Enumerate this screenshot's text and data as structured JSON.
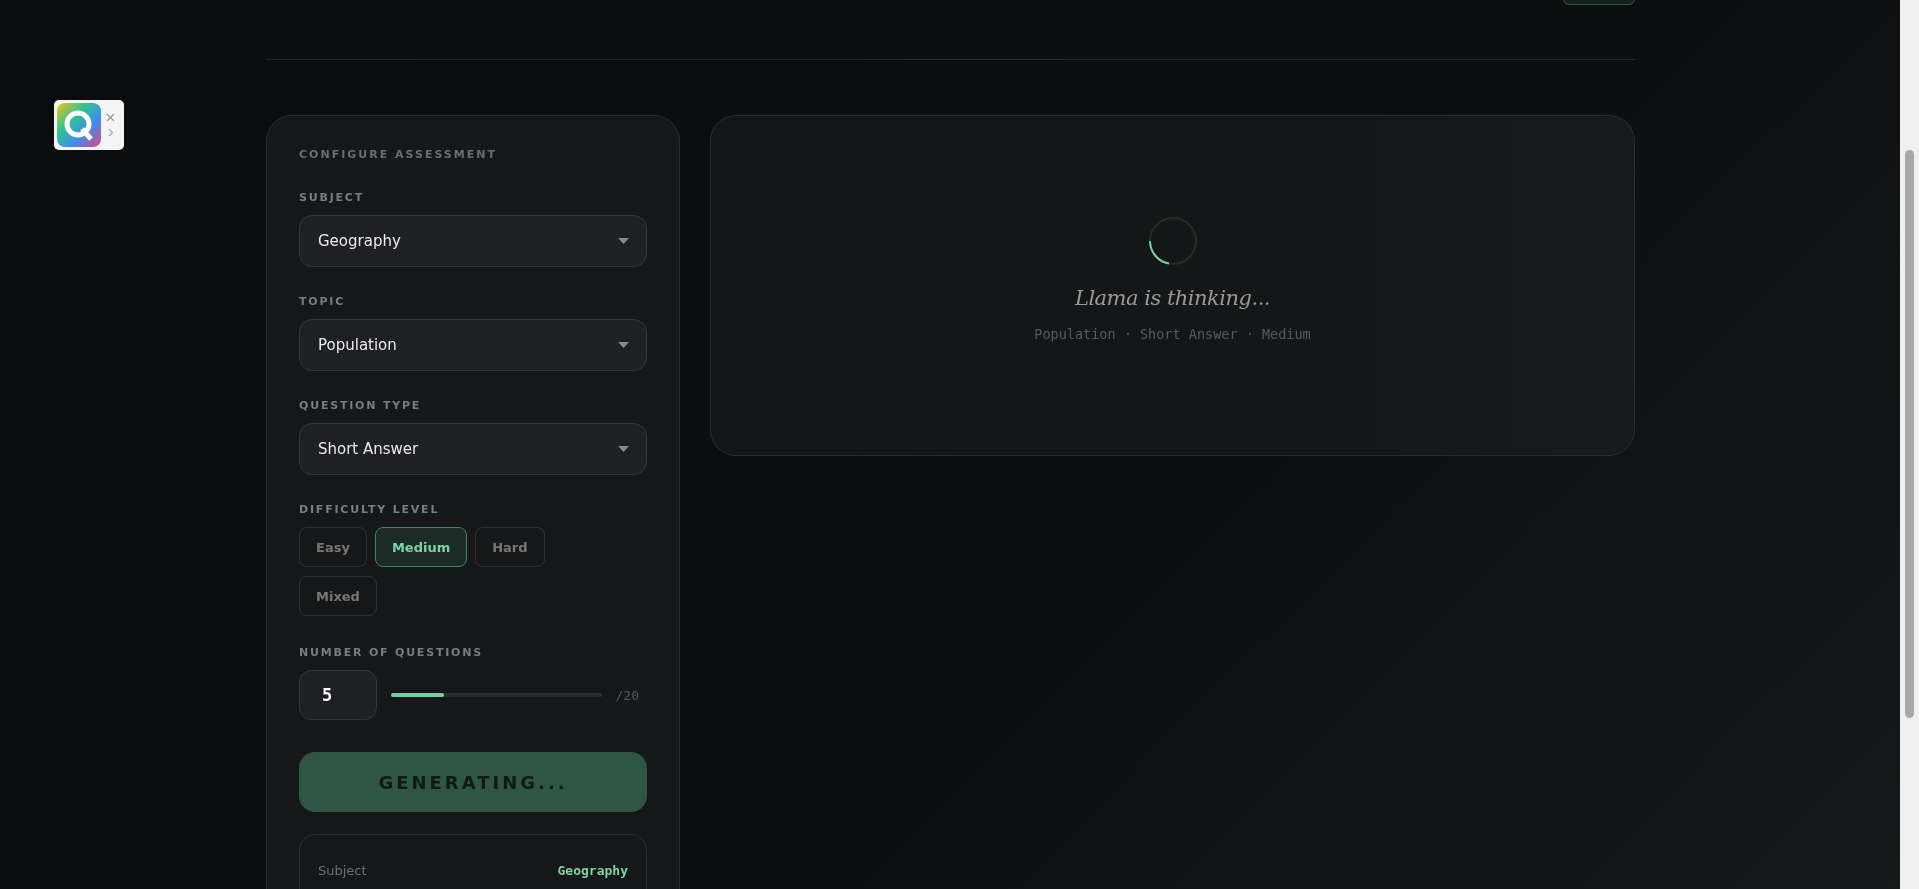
{
  "config": {
    "title": "CONFIGURE ASSESSMENT",
    "selects": [
      {
        "label": "SUBJECT",
        "value": "Geography"
      },
      {
        "label": "TOPIC",
        "value": "Population"
      },
      {
        "label": "QUESTION TYPE",
        "value": "Short Answer"
      }
    ],
    "difficulty": {
      "label": "DIFFICULTY LEVEL",
      "options": [
        {
          "label": "Easy",
          "selected": false
        },
        {
          "label": "Medium",
          "selected": true
        },
        {
          "label": "Hard",
          "selected": false
        },
        {
          "label": "Mixed",
          "selected": false
        }
      ]
    },
    "count": {
      "label": "NUMBER OF QUESTIONS",
      "value": "5",
      "level": 0.25,
      "max": "/20"
    },
    "generate_button": {
      "label": "GENERATING...",
      "disabled": true
    },
    "summary": [
      {
        "label": "Subject",
        "value": "Geography"
      }
    ]
  },
  "status": {
    "title": "Llama is thinking...",
    "subtitle": "Population · Short Answer · Medium"
  }
}
